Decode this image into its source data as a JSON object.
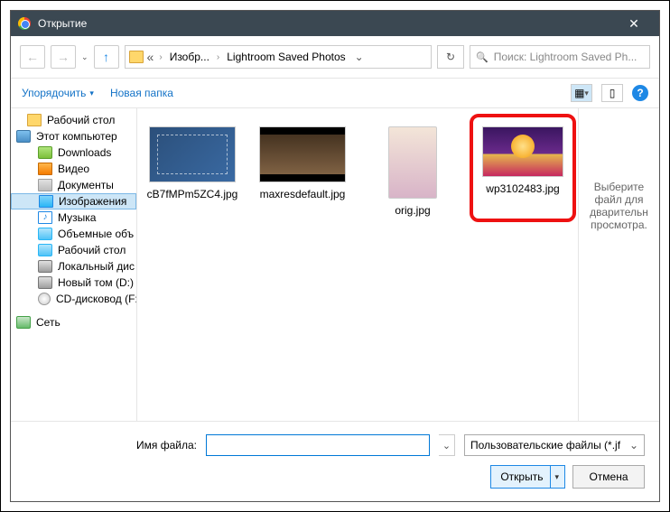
{
  "titlebar": {
    "title": "Открытие"
  },
  "breadcrumb": {
    "item1": "Изобр...",
    "item2": "Lightroom Saved Photos"
  },
  "search": {
    "placeholder": "Поиск: Lightroom Saved Ph..."
  },
  "toolbar": {
    "organize": "Упорядочить",
    "newfolder": "Новая папка"
  },
  "tree": {
    "desktop": "Рабочий стол",
    "thispc": "Этот компьютер",
    "downloads": "Downloads",
    "video": "Видео",
    "documents": "Документы",
    "images": "Изображения",
    "music": "Музыка",
    "volumes": "Объемные объ",
    "desktop2": "Рабочий стол",
    "localdisk": "Локальный дис",
    "newvol": "Новый том (D:)",
    "cddrive": "CD-дисковод (F:",
    "network": "Сеть"
  },
  "files": [
    {
      "name": "cB7fMPm5ZC4.jpg"
    },
    {
      "name": "maxresdefault.jpg"
    },
    {
      "name": "orig.jpg"
    },
    {
      "name": "wp3102483.jpg"
    }
  ],
  "preview": {
    "text": "Выберите файл для дварительн просмотра."
  },
  "filename": {
    "label": "Имя файла:",
    "value": ""
  },
  "filetype": {
    "label": "Пользовательские файлы (*.jf"
  },
  "buttons": {
    "open": "Открыть",
    "cancel": "Отмена"
  }
}
